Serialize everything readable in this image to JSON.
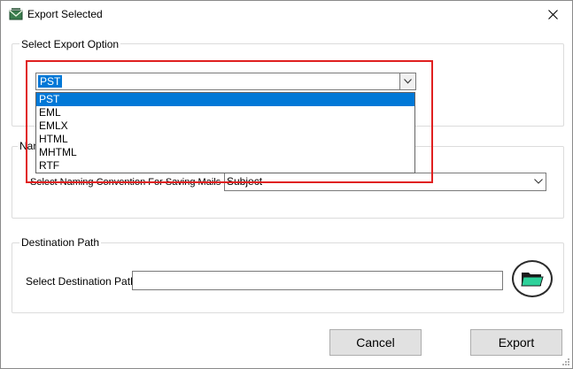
{
  "window": {
    "title": "Export Selected",
    "icons": {
      "app": "app-icon",
      "close": "close-icon"
    }
  },
  "export_option": {
    "legend": "Select Export Option",
    "selected": "PST",
    "options": [
      "PST",
      "EML",
      "EMLX",
      "HTML",
      "MHTML",
      "RTF"
    ]
  },
  "naming": {
    "legend_visible_part": "Nam",
    "label": "Select Naming Convention For Saving Mails",
    "selected": "Subject"
  },
  "destination": {
    "legend": "Destination Path",
    "label": "Select Destination Path",
    "value": "",
    "browse_icon": "folder-icon"
  },
  "buttons": {
    "cancel": "Cancel",
    "export": "Export"
  },
  "colors": {
    "selection": "#0078d7",
    "highlight": "#e02020",
    "folder": "#2ed19a"
  }
}
